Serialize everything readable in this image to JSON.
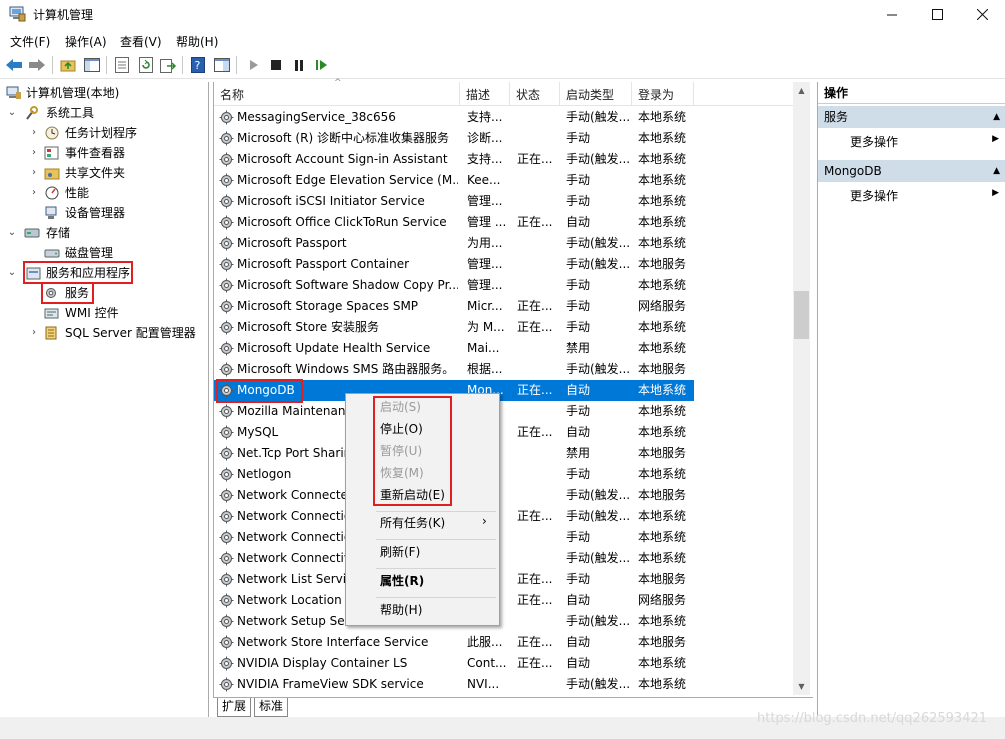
{
  "window": {
    "title": "计算机管理"
  },
  "menu": [
    "文件(F)",
    "操作(A)",
    "查看(V)",
    "帮助(H)"
  ],
  "tree": {
    "root": "计算机管理(本地)",
    "system_tools": "系统工具",
    "task_scheduler": "任务计划程序",
    "event_viewer": "事件查看器",
    "shared_folders": "共享文件夹",
    "performance": "性能",
    "device_manager": "设备管理器",
    "storage": "存储",
    "disk_management": "磁盘管理",
    "services_apps": "服务和应用程序",
    "services": "服务",
    "wmi": "WMI 控件",
    "sql_server": "SQL Server 配置管理器"
  },
  "columns": [
    "名称",
    "描述",
    "状态",
    "启动类型",
    "登录为"
  ],
  "services": [
    {
      "name": "MessagingService_38c656",
      "desc": "支持...",
      "status": "",
      "startup": "手动(触发...",
      "logon": "本地系统"
    },
    {
      "name": "Microsoft (R) 诊断中心标准收集器服务",
      "desc": "诊断...",
      "status": "",
      "startup": "手动",
      "logon": "本地系统"
    },
    {
      "name": "Microsoft Account Sign-in Assistant",
      "desc": "支持...",
      "status": "正在...",
      "startup": "手动(触发...",
      "logon": "本地系统"
    },
    {
      "name": "Microsoft Edge Elevation Service (M...",
      "desc": "Kee...",
      "status": "",
      "startup": "手动",
      "logon": "本地系统"
    },
    {
      "name": "Microsoft iSCSI Initiator Service",
      "desc": "管理...",
      "status": "",
      "startup": "手动",
      "logon": "本地系统"
    },
    {
      "name": "Microsoft Office ClickToRun Service",
      "desc": "管理 ...",
      "status": "正在...",
      "startup": "自动",
      "logon": "本地系统"
    },
    {
      "name": "Microsoft Passport",
      "desc": "为用...",
      "status": "",
      "startup": "手动(触发...",
      "logon": "本地系统"
    },
    {
      "name": "Microsoft Passport Container",
      "desc": "管理...",
      "status": "",
      "startup": "手动(触发...",
      "logon": "本地服务"
    },
    {
      "name": "Microsoft Software Shadow Copy Pr...",
      "desc": "管理...",
      "status": "",
      "startup": "手动",
      "logon": "本地系统"
    },
    {
      "name": "Microsoft Storage Spaces SMP",
      "desc": "Micr...",
      "status": "正在...",
      "startup": "手动",
      "logon": "网络服务"
    },
    {
      "name": "Microsoft Store 安装服务",
      "desc": "为 M...",
      "status": "正在...",
      "startup": "手动",
      "logon": "本地系统"
    },
    {
      "name": "Microsoft Update Health Service",
      "desc": "Mai...",
      "status": "",
      "startup": "禁用",
      "logon": "本地系统"
    },
    {
      "name": "Microsoft Windows SMS 路由器服务。",
      "desc": "根据...",
      "status": "",
      "startup": "手动(触发...",
      "logon": "本地服务"
    },
    {
      "name": "MongoDB",
      "desc": "Mon...",
      "status": "正在...",
      "startup": "自动",
      "logon": "本地系统"
    },
    {
      "name": "Mozilla Maintenance",
      "desc": "",
      "status": "",
      "startup": "手动",
      "logon": "本地系统"
    },
    {
      "name": "MySQL",
      "desc": "",
      "status": "正在...",
      "startup": "自动",
      "logon": "本地系统"
    },
    {
      "name": "Net.Tcp Port Sharing",
      "desc": "",
      "status": "",
      "startup": "禁用",
      "logon": "本地服务"
    },
    {
      "name": "Netlogon",
      "desc": "",
      "status": "",
      "startup": "手动",
      "logon": "本地系统"
    },
    {
      "name": "Network Connected",
      "desc": "",
      "status": "",
      "startup": "手动(触发...",
      "logon": "本地服务"
    },
    {
      "name": "Network Connection",
      "desc": "",
      "status": "正在...",
      "startup": "手动(触发...",
      "logon": "本地系统"
    },
    {
      "name": "Network Connection",
      "desc": "",
      "status": "",
      "startup": "手动",
      "logon": "本地系统"
    },
    {
      "name": "Network Connectivi",
      "desc": "",
      "status": "",
      "startup": "手动(触发...",
      "logon": "本地系统"
    },
    {
      "name": "Network List Servic",
      "desc": "",
      "status": "正在...",
      "startup": "手动",
      "logon": "本地服务"
    },
    {
      "name": "Network Location A",
      "desc": "",
      "status": "正在...",
      "startup": "自动",
      "logon": "网络服务"
    },
    {
      "name": "Network Setup Serv",
      "desc": "",
      "status": "",
      "startup": "手动(触发...",
      "logon": "本地系统"
    },
    {
      "name": "Network Store Interface Service",
      "desc": "此服...",
      "status": "正在...",
      "startup": "自动",
      "logon": "本地服务"
    },
    {
      "name": "NVIDIA Display Container LS",
      "desc": "Cont...",
      "status": "正在...",
      "startup": "自动",
      "logon": "本地系统"
    },
    {
      "name": "NVIDIA FrameView SDK service",
      "desc": "NVI...",
      "status": "",
      "startup": "手动(触发...",
      "logon": "本地系统"
    }
  ],
  "tabs": [
    "扩展",
    "标准"
  ],
  "actions": {
    "header": "操作",
    "group1": "服务",
    "group1_more": "更多操作",
    "group2": "MongoDB",
    "group2_more": "更多操作"
  },
  "context_menu": {
    "start": "启动(S)",
    "stop": "停止(O)",
    "pause": "暂停(U)",
    "resume": "恢复(M)",
    "restart": "重新启动(E)",
    "all_tasks": "所有任务(K)",
    "refresh": "刷新(F)",
    "properties": "属性(R)",
    "help": "帮助(H)"
  },
  "watermark": "https://blog.csdn.net/qq262593421",
  "colors": {
    "selection": "#0078d7",
    "highlight_box": "#e02020"
  }
}
